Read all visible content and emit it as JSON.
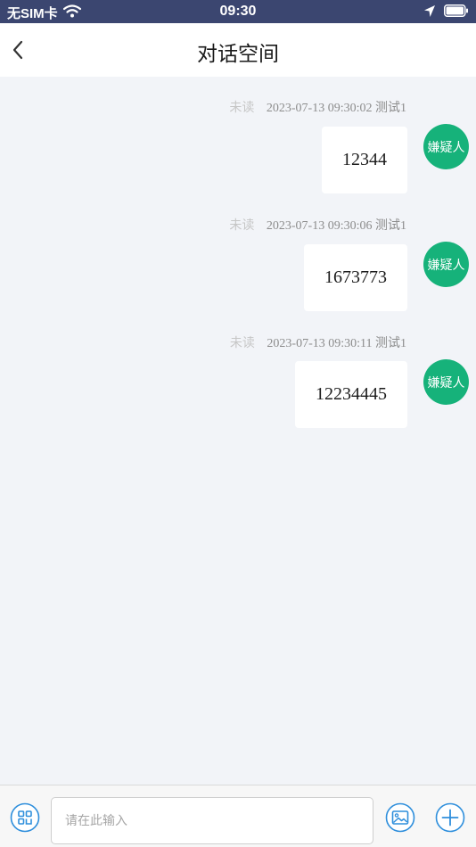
{
  "status_bar": {
    "carrier": "无SIM卡",
    "time": "09:30",
    "icons": [
      "wifi-icon",
      "location-arrow-icon",
      "battery-icon"
    ]
  },
  "nav": {
    "title": "对话空间",
    "back_icon": "chevron-left-icon"
  },
  "messages": [
    {
      "status": "未读",
      "timestamp": "2023-07-13 09:30:02",
      "sender": "测试1",
      "text": "12344",
      "avatar_label": "嫌疑人"
    },
    {
      "status": "未读",
      "timestamp": "2023-07-13 09:30:06",
      "sender": "测试1",
      "text": "1673773",
      "avatar_label": "嫌疑人"
    },
    {
      "status": "未读",
      "timestamp": "2023-07-13 09:30:11",
      "sender": "测试1",
      "text": "12234445",
      "avatar_label": "嫌疑人"
    }
  ],
  "input_bar": {
    "placeholder": "请在此输入",
    "left_icon": "qr-code-icon",
    "image_icon": "image-icon",
    "add_icon": "plus-icon"
  },
  "colors": {
    "status_bar_bg": "#3b4670",
    "avatar_bg": "#16b27a",
    "icon_blue": "#2f8fdc",
    "chat_bg": "#f2f4f8"
  }
}
